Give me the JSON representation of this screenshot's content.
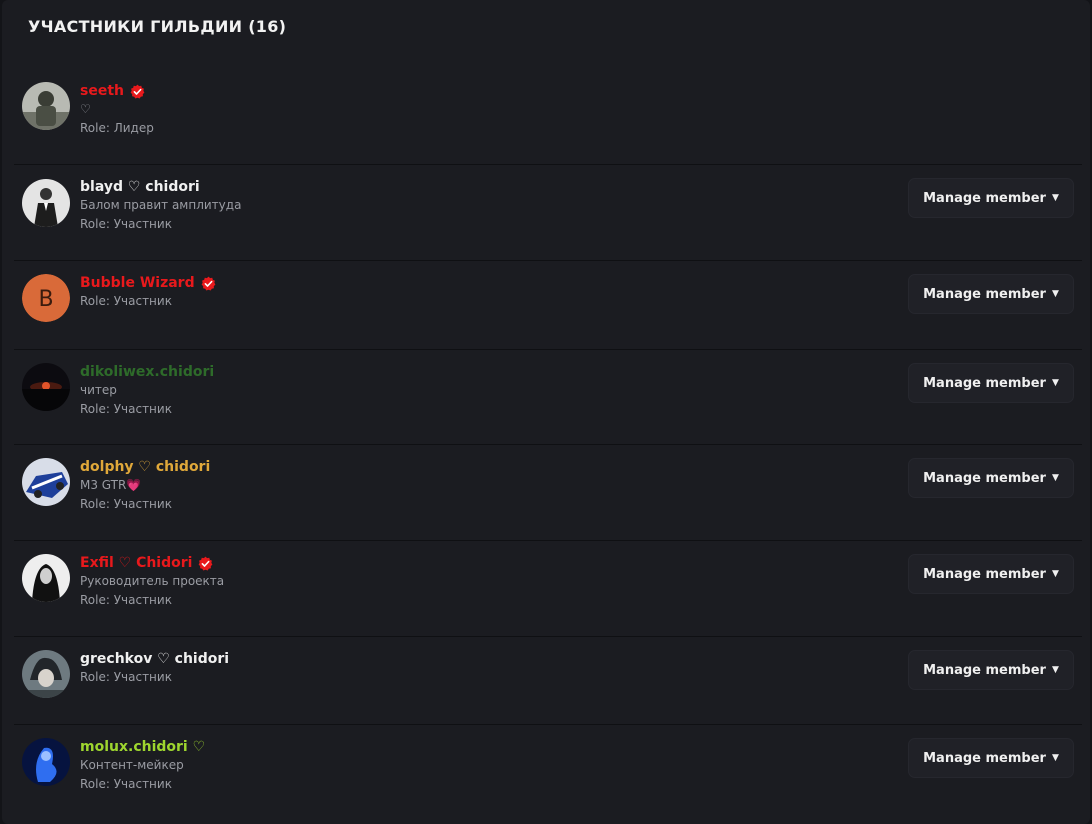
{
  "panel": {
    "title": "УЧАСТНИКИ ГИЛЬДИИ (16)"
  },
  "members": [
    {
      "name": "seeth",
      "name_color": "#e8191c",
      "verified": true,
      "bio": "♡",
      "role": "Role: Лидер",
      "manage": null,
      "avatar": "photo-soldier"
    },
    {
      "name": "blayd ♡ chidori",
      "name_color": "#f0f0f0",
      "verified": false,
      "bio": "Балом правит амплитуда",
      "role": "Role: Участник",
      "manage": "Manage member",
      "avatar": "photo-suit"
    },
    {
      "name": "Bubble Wizard",
      "name_color": "#e8191c",
      "verified": true,
      "bio": "",
      "role": "Role: Участник",
      "manage": "Manage member",
      "avatar": "letter",
      "avatar_letter": "B",
      "avatar_color": "#d96a39"
    },
    {
      "name": "dikoliwex.chidori",
      "name_color": "#2e6b2a",
      "verified": false,
      "bio": "читер",
      "role": "Role: Участник",
      "manage": "Manage member",
      "avatar": "photo-sunset"
    },
    {
      "name": "dolphy ♡ chidori",
      "name_color": "#e0a83a",
      "verified": false,
      "bio": "M3 GTR💗",
      "role": "Role: Участник",
      "manage": "Manage member",
      "avatar": "photo-car"
    },
    {
      "name": "Exfil ♡ Chidori",
      "name_color": "#e8191c",
      "verified": true,
      "bio": "Руководитель проекта",
      "role": "Role: Участник",
      "manage": "Manage member",
      "avatar": "photo-girl"
    },
    {
      "name": "grechkov ♡ chidori",
      "name_color": "#f0f0f0",
      "verified": false,
      "bio": "",
      "role": "Role: Участник",
      "manage": "Manage member",
      "avatar": "photo-anime"
    },
    {
      "name": "molux.chidori ♡",
      "name_color": "#9ed62f",
      "verified": false,
      "bio": "Контент-мейкер",
      "role": "Role: Участник",
      "manage": "Manage member",
      "avatar": "photo-blue"
    }
  ],
  "colors": {
    "background": "#1b1c21",
    "verified_badge": "#e8191c",
    "button_bg": "#202127"
  }
}
